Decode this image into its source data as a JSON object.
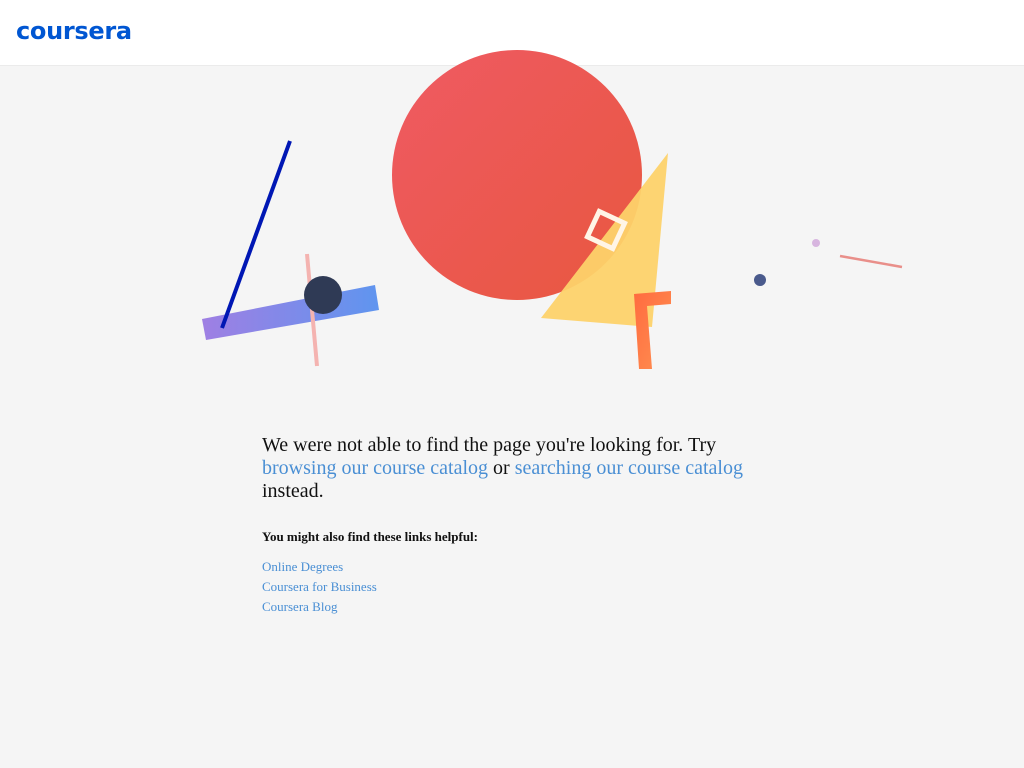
{
  "header": {
    "logo_text": "coursera"
  },
  "message": {
    "lead": "We were not able to find the page you're looking for. Try ",
    "link_browse": "browsing our course catalog",
    "connector": " or ",
    "link_search": "searching our course catalog",
    "tail": " instead."
  },
  "helpful": {
    "heading": "You might also find these links helpful:",
    "links": [
      {
        "label": "Online Degrees"
      },
      {
        "label": "Coursera for Business"
      },
      {
        "label": "Coursera Blog"
      }
    ]
  },
  "colors": {
    "brand": "#0056d2",
    "link": "#4a8fd4",
    "page_background": "#f5f5f5",
    "circle_red": "#ec5a55",
    "triangle_yellow": "#fdd26a",
    "bar_blue": "#0017b4",
    "accent_orange": "#ff7a3d",
    "accent_pink": "#f3a8a5",
    "dot_navy": "#2f3a55"
  }
}
